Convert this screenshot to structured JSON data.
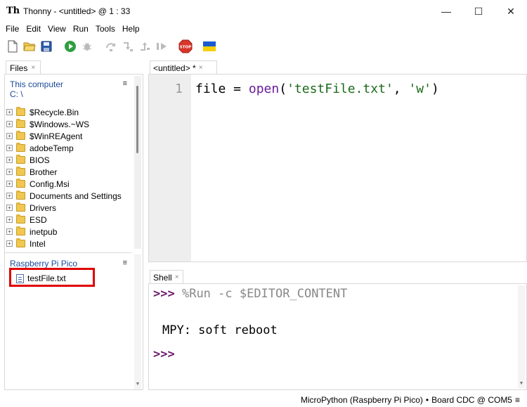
{
  "window": {
    "title": "Thonny  -  <untitled>  @  1 : 33",
    "minimize_glyph": "—",
    "maximize_glyph": "☐",
    "close_glyph": "✕"
  },
  "menu": [
    "File",
    "Edit",
    "View",
    "Run",
    "Tools",
    "Help"
  ],
  "toolbar": {
    "icons": [
      "new-file-icon",
      "open-file-icon",
      "save-icon",
      "run-icon",
      "debug-icon",
      "step-over-icon",
      "step-into-icon",
      "step-out-icon",
      "resume-icon",
      "stop-icon",
      "ukraine-flag-icon"
    ],
    "stop_label": "STOP"
  },
  "files_panel": {
    "tab_label": "Files",
    "tab_close": "×",
    "computer_heading": "This computer",
    "computer_path": "C: \\",
    "menu_glyph": "≡",
    "folders": [
      "$Recycle.Bin",
      "$Windows.~WS",
      "$WinREAgent",
      "adobeTemp",
      "BIOS",
      "Brother",
      "Config.Msi",
      "Documents and Settings",
      "Drivers",
      "ESD",
      "inetpub",
      "Intel"
    ],
    "expander": "+",
    "pico_heading": "Raspberry Pi Pico",
    "pico_files": [
      "testFile.txt"
    ]
  },
  "editor": {
    "tab_label": "<untitled> *",
    "tab_close": "×",
    "line_number": "1",
    "code": {
      "t1": "file = ",
      "t2": "open",
      "t3": "(",
      "t4": "'testFile.txt'",
      "t5": ", ",
      "t6": "'w'",
      "t7": ")"
    }
  },
  "shell": {
    "tab_label": "Shell",
    "tab_close": "×",
    "prompt": ">>>",
    "command": "%Run -c $EDITOR_CONTENT",
    "output": "MPY: soft reboot"
  },
  "status": {
    "interpreter": "MicroPython (Raspberry Pi Pico)",
    "separator": "•",
    "port": "Board CDC @ COM5",
    "menu_glyph": "≡"
  },
  "colors": {
    "accent_blue": "#1a4a9a",
    "highlight_red": "#e00000",
    "prompt_purple": "#6a1b6a",
    "string_green": "#1a6a1a"
  }
}
